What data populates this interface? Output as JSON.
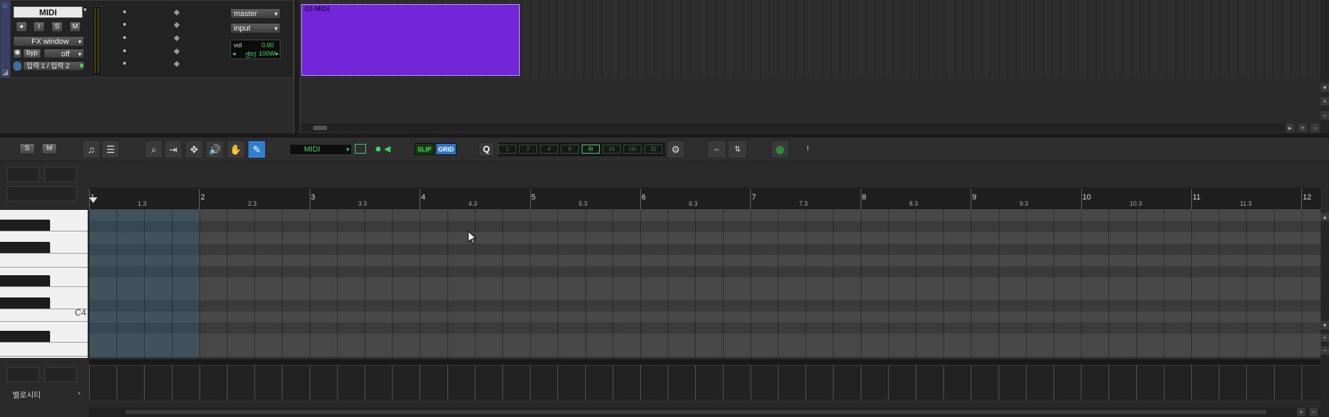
{
  "track": {
    "name": "MIDI",
    "output": "master",
    "input": "input",
    "fx_window": "FX window",
    "bypass": "byp",
    "bypass_state": "off",
    "io_label": "입력 1 / 입력 2",
    "vol_label": "vol",
    "vol_value": "0.00",
    "pan_label": "센터",
    "pan_value": "100W",
    "buttons": {
      "record": "●",
      "input_monitor": "I",
      "solo": "S",
      "mute": "M"
    }
  },
  "clip": {
    "name": "02-MIDI",
    "color": "#7326d9"
  },
  "toolbar": {
    "solo": "S",
    "mute": "M",
    "midi_channel": "MIDI",
    "slip": "SLIP",
    "grid": "GRID",
    "quantize": "Q",
    "quantize_values": [
      "1",
      "2",
      "4",
      "8",
      "8t",
      "16",
      "16t",
      "32"
    ],
    "active_quantize": "8t"
  },
  "ruler": {
    "bars": [
      "1",
      "2",
      "3",
      "4",
      "5",
      "6",
      "7",
      "8",
      "9",
      "10",
      "11",
      "12"
    ],
    "sub_labels": [
      "1.3",
      "2.3",
      "3.3",
      "4.3",
      "5.3",
      "6.3",
      "7.3",
      "8.3",
      "9.3",
      "10.3",
      "11.3"
    ]
  },
  "keyboard": {
    "c4_label": "C4"
  },
  "velocity": {
    "label": "벨로시티"
  },
  "colors": {
    "accent": "#2f7fd2",
    "clip": "#7326d9",
    "led_green": "#3fd46a"
  }
}
